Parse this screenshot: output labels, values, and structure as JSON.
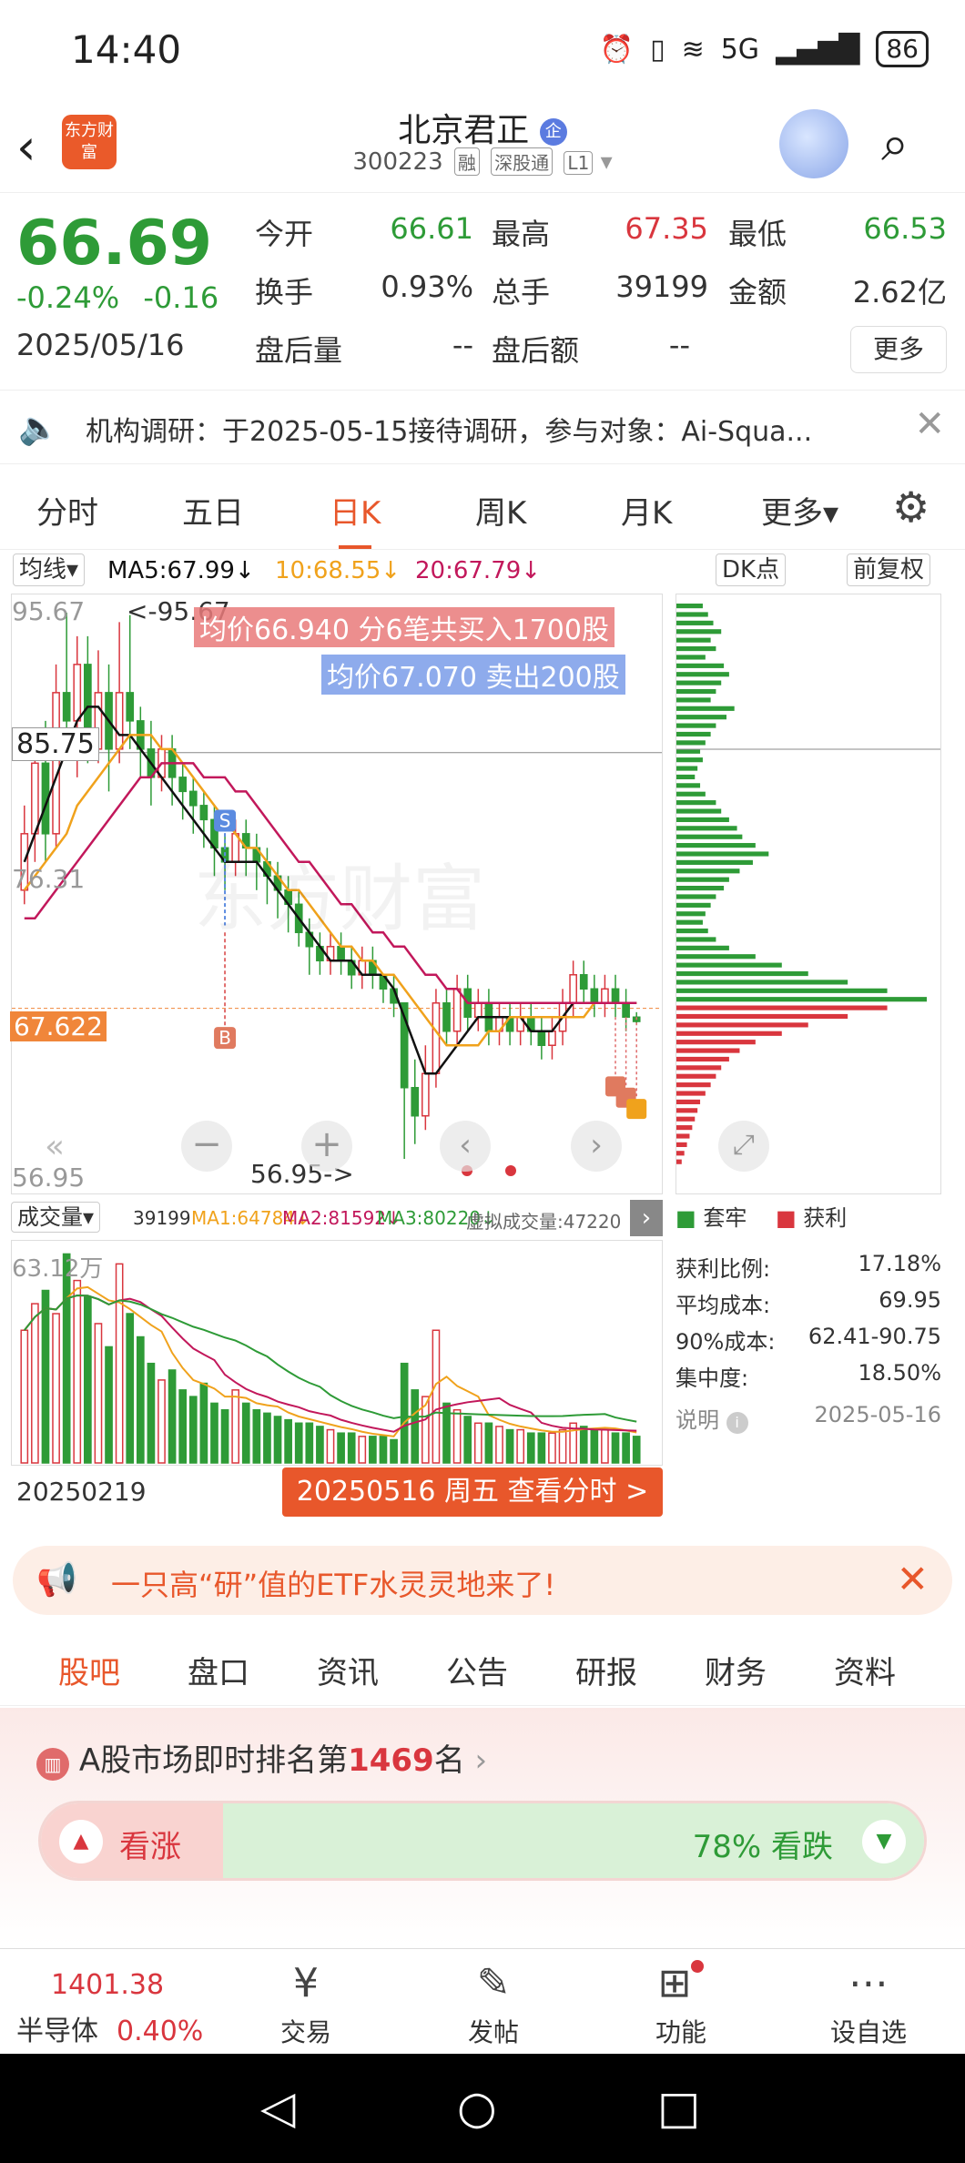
{
  "status": {
    "time": "14:40",
    "signal": "5G",
    "battery": "86"
  },
  "header": {
    "title": "北京君正",
    "badge": "企",
    "code": "300223",
    "tag1": "融",
    "tag2": "深股通",
    "tag3": "L1",
    "logo": "东方财富"
  },
  "quote": {
    "price": "66.69",
    "change_pct": "-0.24%",
    "change": "-0.16",
    "date": "2025/05/16",
    "open_label": "今开",
    "open": "66.61",
    "high_label": "最高",
    "high": "67.35",
    "low_label": "最低",
    "low": "66.53",
    "turnover_label": "换手",
    "turnover": "0.93%",
    "volume_label": "总手",
    "volume": "39199",
    "amount_label": "金额",
    "amount": "2.62亿",
    "after_vol_label": "盘后量",
    "after_vol": "--",
    "after_amt_label": "盘后额",
    "after_amt": "--",
    "more": "更多"
  },
  "notice": {
    "text": "机构调研：于2025-05-15接待调研，参与对象：Ai-Squa..."
  },
  "period_tabs": [
    "分时",
    "五日",
    "日K",
    "周K",
    "月K",
    "更多▾"
  ],
  "chart": {
    "ma_select": "均线▾",
    "ma5": "MA5:67.99↓",
    "ma10": "10:68.55↓",
    "ma20": "20:67.79↓",
    "dk": "DK点",
    "adjust": "前复权",
    "top_label": "95.67",
    "top_marker": "<-95.67",
    "cross_label": "85.75",
    "mid_label": "76.31",
    "last_label": "67.622",
    "bottom_label": "56.95",
    "bottom_marker": "56.95->",
    "buy_note": "均价66.940  分6笔共买入1700股",
    "sell_note": "均价67.070  卖出200股",
    "watermark": "东方财富",
    "vol_select": "成交量▾",
    "vol": "39199",
    "vma1": "MA1:64784↓",
    "vma2": "MA2:81592↓",
    "vma3": "MA3:80220↓",
    "virtual": "虚拟成交量:47220",
    "vol_top": "63.12万",
    "start_date": "20250219",
    "sel_date": "20250516 周五 查看分时 >"
  },
  "chips": {
    "legend_trap": "套牢",
    "legend_profit": "获利",
    "rows": [
      {
        "label": "获利比例:",
        "value": "17.18%"
      },
      {
        "label": "平均成本:",
        "value": "69.95"
      },
      {
        "label": "90%成本:",
        "value": "62.41-90.75"
      },
      {
        "label": "集中度:",
        "value": "18.50%"
      }
    ],
    "note_label": "说明",
    "note_date": "2025-05-16"
  },
  "chart_data": {
    "type": "candlestick",
    "y_range": [
      56.95,
      95.67
    ],
    "candles": [
      {
        "o": 76,
        "c": 80,
        "h": 82,
        "l": 75
      },
      {
        "o": 80,
        "c": 85,
        "h": 86,
        "l": 78
      },
      {
        "o": 85,
        "c": 80,
        "h": 88,
        "l": 78
      },
      {
        "o": 80,
        "c": 90,
        "h": 92,
        "l": 79
      },
      {
        "o": 90,
        "c": 88,
        "h": 95.67,
        "l": 86
      },
      {
        "o": 88,
        "c": 92,
        "h": 94,
        "l": 84
      },
      {
        "o": 92,
        "c": 86,
        "h": 94,
        "l": 85
      },
      {
        "o": 86,
        "c": 90,
        "h": 93,
        "l": 85
      },
      {
        "o": 90,
        "c": 86,
        "h": 92,
        "l": 83
      },
      {
        "o": 86,
        "c": 90,
        "h": 95,
        "l": 85
      },
      {
        "o": 90,
        "c": 88,
        "h": 95.5,
        "l": 86
      },
      {
        "o": 88,
        "c": 86,
        "h": 89,
        "l": 84
      },
      {
        "o": 86,
        "c": 84,
        "h": 88,
        "l": 82
      },
      {
        "o": 84,
        "c": 86,
        "h": 87,
        "l": 83
      },
      {
        "o": 86,
        "c": 84,
        "h": 87,
        "l": 82
      },
      {
        "o": 84,
        "c": 83,
        "h": 85,
        "l": 81
      },
      {
        "o": 83,
        "c": 82,
        "h": 84,
        "l": 80
      },
      {
        "o": 82,
        "c": 81,
        "h": 83,
        "l": 79
      },
      {
        "o": 81,
        "c": 79,
        "h": 82,
        "l": 77
      },
      {
        "o": 79,
        "c": 78,
        "h": 80,
        "l": 76
      },
      {
        "o": 78,
        "c": 80,
        "h": 81,
        "l": 77
      },
      {
        "o": 80,
        "c": 79,
        "h": 81,
        "l": 77
      },
      {
        "o": 79,
        "c": 78,
        "h": 80,
        "l": 76
      },
      {
        "o": 78,
        "c": 77,
        "h": 79,
        "l": 75
      },
      {
        "o": 77,
        "c": 76,
        "h": 78,
        "l": 74
      },
      {
        "o": 76,
        "c": 75,
        "h": 77,
        "l": 73
      },
      {
        "o": 75,
        "c": 73,
        "h": 76,
        "l": 72
      },
      {
        "o": 73,
        "c": 72,
        "h": 74,
        "l": 70
      },
      {
        "o": 72,
        "c": 71,
        "h": 73,
        "l": 70
      },
      {
        "o": 71,
        "c": 72,
        "h": 73,
        "l": 70
      },
      {
        "o": 72,
        "c": 71,
        "h": 73,
        "l": 70
      },
      {
        "o": 71,
        "c": 70,
        "h": 72,
        "l": 69
      },
      {
        "o": 70,
        "c": 71,
        "h": 72,
        "l": 69
      },
      {
        "o": 71,
        "c": 70,
        "h": 72,
        "l": 69
      },
      {
        "o": 70,
        "c": 69,
        "h": 70,
        "l": 68
      },
      {
        "o": 69,
        "c": 68,
        "h": 70,
        "l": 67
      },
      {
        "o": 68,
        "c": 62,
        "h": 68,
        "l": 56.95
      },
      {
        "o": 62,
        "c": 60,
        "h": 64,
        "l": 58
      },
      {
        "o": 60,
        "c": 63,
        "h": 65,
        "l": 59
      },
      {
        "o": 63,
        "c": 68,
        "h": 69,
        "l": 62
      },
      {
        "o": 68,
        "c": 66,
        "h": 69,
        "l": 65
      },
      {
        "o": 66,
        "c": 69,
        "h": 70,
        "l": 65
      },
      {
        "o": 69,
        "c": 67,
        "h": 70,
        "l": 66
      },
      {
        "o": 67,
        "c": 68,
        "h": 69,
        "l": 66
      },
      {
        "o": 68,
        "c": 66,
        "h": 69,
        "l": 65
      },
      {
        "o": 66,
        "c": 67,
        "h": 68,
        "l": 65
      },
      {
        "o": 67,
        "c": 66,
        "h": 68,
        "l": 65
      },
      {
        "o": 66,
        "c": 67,
        "h": 68,
        "l": 65
      },
      {
        "o": 67,
        "c": 66,
        "h": 68,
        "l": 65
      },
      {
        "o": 66,
        "c": 65,
        "h": 67,
        "l": 64
      },
      {
        "o": 65,
        "c": 66,
        "h": 67,
        "l": 64
      },
      {
        "o": 66,
        "c": 68,
        "h": 69,
        "l": 65
      },
      {
        "o": 68,
        "c": 70,
        "h": 71,
        "l": 67
      },
      {
        "o": 70,
        "c": 69,
        "h": 71,
        "l": 68
      },
      {
        "o": 69,
        "c": 68,
        "h": 70,
        "l": 67
      },
      {
        "o": 68,
        "c": 69,
        "h": 70,
        "l": 67
      },
      {
        "o": 69,
        "c": 68,
        "h": 70,
        "l": 67
      },
      {
        "o": 68,
        "c": 67,
        "h": 69,
        "l": 66
      },
      {
        "o": 67,
        "c": 66.69,
        "h": 67.35,
        "l": 66.53
      }
    ],
    "ma5": [
      78,
      80,
      82,
      84,
      86,
      88,
      89,
      89,
      88,
      87,
      87,
      86,
      85,
      84,
      83,
      82,
      81,
      80,
      79,
      78,
      78,
      78,
      78,
      77,
      76,
      75,
      74,
      73,
      72,
      71,
      71,
      71,
      70,
      70,
      70,
      69,
      67,
      65,
      63,
      63,
      64,
      65,
      66,
      67,
      67,
      67,
      67,
      67,
      66,
      66,
      66,
      67,
      68,
      68,
      68,
      68,
      68,
      68,
      68
    ],
    "ma10": [
      76,
      77,
      78,
      79,
      80,
      82,
      83,
      84,
      85,
      86,
      87,
      87,
      87,
      86,
      86,
      85,
      84,
      83,
      82,
      81,
      80,
      79,
      79,
      78,
      77,
      76,
      76,
      75,
      74,
      73,
      72,
      72,
      71,
      71,
      70,
      70,
      69,
      68,
      67,
      66,
      65,
      65,
      65,
      65,
      66,
      66,
      67,
      67,
      67,
      67,
      67,
      67,
      67,
      67,
      68,
      68,
      68,
      68,
      68
    ],
    "ma20": [
      74,
      74,
      75,
      76,
      77,
      78,
      79,
      80,
      81,
      82,
      83,
      84,
      84,
      85,
      85,
      85,
      85,
      84,
      84,
      84,
      83,
      83,
      82,
      81,
      80,
      79,
      78,
      78,
      77,
      76,
      75,
      75,
      74,
      73,
      73,
      72,
      72,
      71,
      70,
      70,
      69,
      69,
      68,
      68,
      68,
      68,
      68,
      68,
      68,
      68,
      68,
      68,
      68,
      68,
      68,
      68,
      68,
      68,
      68
    ],
    "volume": [
      40,
      48,
      52,
      45,
      63,
      55,
      50,
      42,
      35,
      60,
      45,
      38,
      30,
      25,
      28,
      22,
      20,
      24,
      18,
      16,
      22,
      18,
      16,
      15,
      14,
      13,
      12,
      12,
      11,
      10,
      9,
      9,
      8,
      8,
      8,
      7,
      30,
      22,
      20,
      40,
      18,
      16,
      14,
      12,
      12,
      11,
      10,
      10,
      9,
      9,
      9,
      10,
      12,
      11,
      10,
      10,
      9,
      9,
      8
    ],
    "profile": [
      20,
      24,
      28,
      34,
      26,
      30,
      22,
      36,
      40,
      34,
      30,
      26,
      44,
      38,
      30,
      26,
      22,
      18,
      20,
      16,
      14,
      18,
      22,
      30,
      34,
      40,
      46,
      50,
      60,
      70,
      58,
      48,
      40,
      36,
      30,
      26,
      22,
      20,
      24,
      30,
      40,
      60,
      80,
      100,
      130,
      160,
      190,
      160,
      130,
      100,
      80,
      60,
      48,
      40,
      34,
      30,
      26,
      22,
      18,
      16,
      14,
      12,
      10,
      8,
      6,
      4
    ],
    "profile_split": 47
  },
  "banner": {
    "text": "一只高“研”值的ETF水灵灵地来了!"
  },
  "bottom_tabs": [
    "股吧",
    "盘口",
    "资讯",
    "公告",
    "研报",
    "财务",
    "资料"
  ],
  "rank": {
    "pre": "A股市场即时排名第",
    "num": "1469",
    "post": "名",
    "up": "看涨",
    "down": "78% 看跌"
  },
  "nav": {
    "index_price": "1401.38",
    "index_name": "半导体",
    "index_pct": "0.40%",
    "trade": "交易",
    "post": "发帖",
    "func": "功能",
    "custom": "设自选"
  },
  "colors": {
    "up": "#d9363e",
    "down": "#2e9b37",
    "accent": "#e8572b",
    "ma5": "#111111",
    "ma10": "#f0a21c",
    "ma20": "#c2185b"
  }
}
